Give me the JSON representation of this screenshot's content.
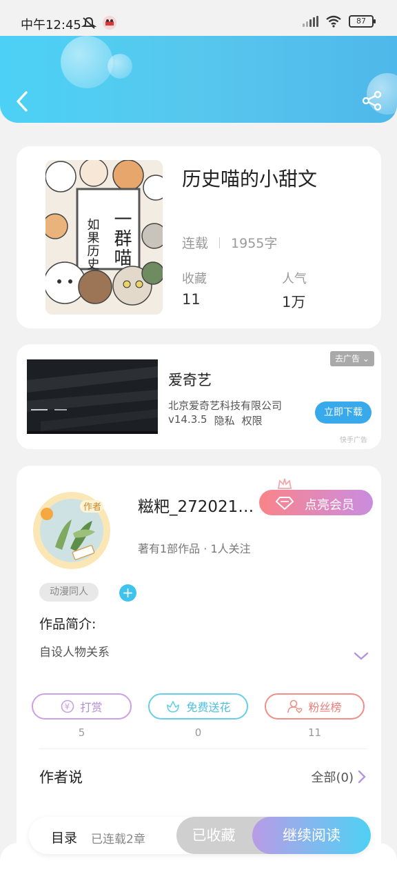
{
  "status_bar": {
    "time": "中午12:45",
    "battery": "87"
  },
  "book": {
    "title": "历史喵的小甜文",
    "status": "连载",
    "word_count": "1955字",
    "favorites_label": "收藏",
    "favorites_value": "11",
    "popularity_label": "人气",
    "popularity_value": "1万",
    "cover_text": [
      "如果历史",
      "一群喵"
    ]
  },
  "ad": {
    "remove_label": "去广告",
    "app_name": "爱奇艺",
    "company": "北京爱奇艺科技有限公司",
    "version": "v14.3.5",
    "privacy": "隐私",
    "permissions": "权限",
    "download_label": "立即下载",
    "source": "快手广告"
  },
  "author": {
    "name": "糍粑_272021…",
    "badge": "作者",
    "vip_label": "点亮会员",
    "stats": "著有1部作品 · 1人关注",
    "tag": "动漫同人",
    "intro_label": "作品简介:",
    "intro_text": "自设人物关系",
    "actions": [
      {
        "label": "打赏",
        "count": "5",
        "color": "#c9a0e4"
      },
      {
        "label": "免费送花",
        "count": "0",
        "color": "#66cfe6"
      },
      {
        "label": "粉丝榜",
        "count": "11",
        "color": "#f08e86"
      }
    ],
    "author_says_label": "作者说",
    "author_says_all": "全部(0)"
  },
  "bottom_bar": {
    "catalog": "目录",
    "chapters": "已连载2章",
    "collected": "已收藏",
    "continue": "继续阅读"
  },
  "colors": {
    "header": "#4fc6ee",
    "accent": "#3dc3ee"
  }
}
